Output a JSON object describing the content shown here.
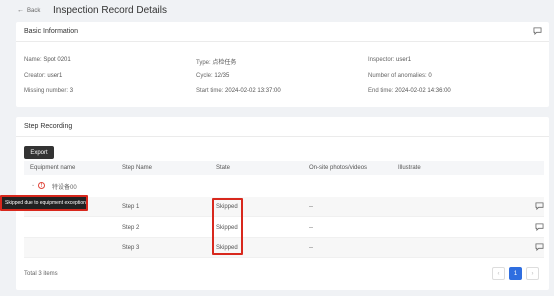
{
  "header": {
    "back_label": "Back",
    "title": "Inspection Record Details"
  },
  "basic": {
    "title": "Basic Information",
    "fields": {
      "name": {
        "label": "Name:",
        "value": "Spot 0201"
      },
      "type": {
        "label": "Type:",
        "value": "点检任务"
      },
      "inspector": {
        "label": "Inspector:",
        "value": "user1"
      },
      "creator": {
        "label": "Creator:",
        "value": "user1"
      },
      "cycle": {
        "label": "Cycle:",
        "value": "12/35"
      },
      "anomalies": {
        "label": "Number of anomalies:",
        "value": "0"
      },
      "missing": {
        "label": "Missing number:",
        "value": "3"
      },
      "start": {
        "label": "Start time:",
        "value": "2024-02-02 13:37:00"
      },
      "end": {
        "label": "End time:",
        "value": "2024-02-02 14:36:00"
      }
    }
  },
  "steps": {
    "title": "Step Recording",
    "export_label": "Export",
    "columns": [
      "Equipment name",
      "Step Name",
      "State",
      "On-site photos/videos",
      "Illustrate"
    ],
    "group_name": "特设备00",
    "rows": [
      {
        "step": "Step 1",
        "state": "Skipped",
        "media": "--"
      },
      {
        "step": "Step 2",
        "state": "Skipped",
        "media": "--"
      },
      {
        "step": "Step 3",
        "state": "Skipped",
        "media": "--"
      }
    ],
    "tooltip": "Skipped due to equipment exception",
    "total": "Total 3 items",
    "page": "1",
    "prev": "‹",
    "next": "›"
  },
  "colors": {
    "accent": "#2f6ee0",
    "highlight": "#d8281d",
    "warning": "#e0473c"
  }
}
